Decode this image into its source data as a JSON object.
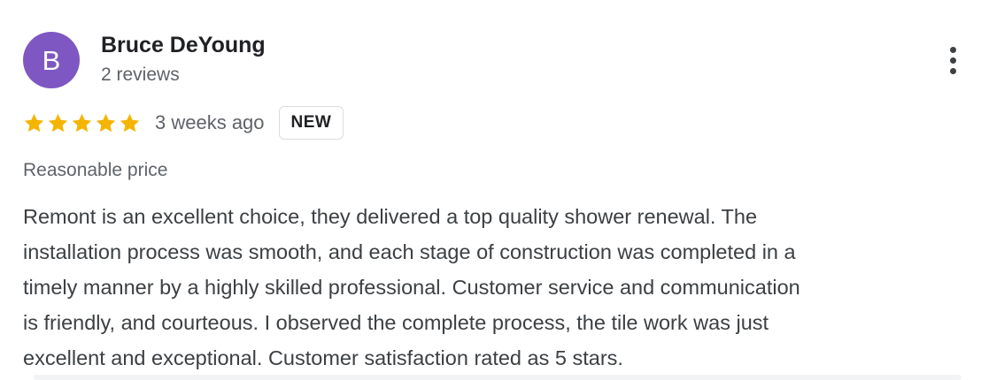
{
  "colors": {
    "avatar_background": "#7E57C2",
    "star_color": "#F4B400"
  },
  "reviewer": {
    "avatar_initial": "B",
    "name": "Bruce DeYoung",
    "review_count": "2 reviews"
  },
  "more_options": {
    "icon": "more-vert-icon"
  },
  "rating": {
    "stars": 5,
    "max_stars": 5,
    "date": "3 weeks ago",
    "badge": "NEW"
  },
  "review": {
    "tag": "Reasonable price",
    "lines": [
      "Remont is an excellent choice, they delivered a top quality shower renewal. The",
      "installation process was smooth, and each stage of construction was completed in a",
      "timely manner by a highly skilled professional. Customer service and communication",
      "is friendly, and courteous. I observed the complete process, the tile work was just",
      "excellent and exceptional. Customer satisfaction rated as 5 stars."
    ]
  }
}
